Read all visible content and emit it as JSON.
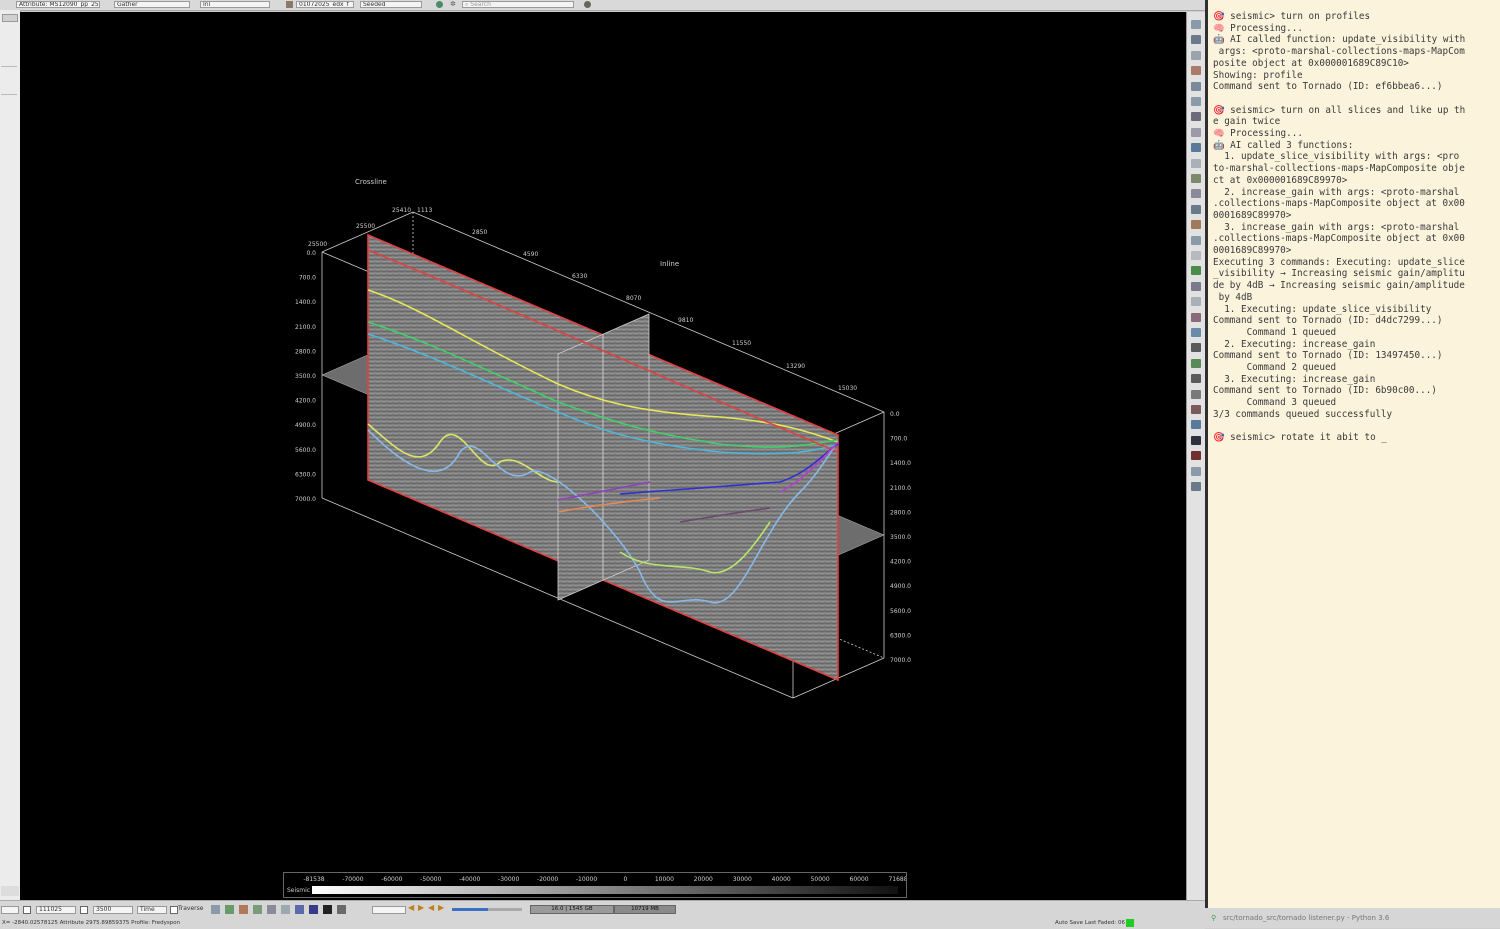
{
  "toolbar": {
    "attribute_field": "Attribute: MS12090_pp_25",
    "gather_field": "Gather",
    "axis_field": "Inl",
    "survey_field": "01072025_edx_f",
    "mode_field": "Seeded",
    "search_placeholder": "Search"
  },
  "viewer": {
    "crossline_label": "Crossline",
    "inline_label": "Inline",
    "top_tick_labels": [
      "25500",
      "25410",
      "1113",
      "2850",
      "4590",
      "6330",
      "8070",
      "9810",
      "11550",
      "13290",
      "15030"
    ],
    "left_depth_labels": [
      "0.0",
      "700.0",
      "1400.0",
      "2100.0",
      "2800.0",
      "3500.0",
      "4200.0",
      "4900.0",
      "5600.0",
      "6300.0",
      "7000.0"
    ],
    "left_top_label": "25500",
    "right_depth_labels": [
      "0.0",
      "700.0",
      "1400.0",
      "2100.0",
      "2800.0",
      "3500.0",
      "4200.0",
      "4900.0",
      "5600.0",
      "6300.0",
      "7000.0"
    ],
    "colorbar_ticks": [
      "-81538",
      "-70000",
      "-60000",
      "-50000",
      "-40000",
      "-30000",
      "-20000",
      "-10000",
      "0",
      "10000",
      "20000",
      "30000",
      "40000",
      "50000",
      "60000",
      "71688"
    ],
    "colorbar_label": "Seismic"
  },
  "terminal": {
    "lines": [
      {
        "text": "🎯 seismic> turn on profiles",
        "cls": "pr"
      },
      {
        "text": "🧠 Processing...",
        "cls": "pc"
      },
      {
        "text": "🤖 AI called function: update_visibility with",
        "cls": ""
      },
      {
        "text": " args: <proto-marshal-collections-maps-MapCom",
        "cls": ""
      },
      {
        "text": "posite object at 0x000001689C89C10>",
        "cls": ""
      },
      {
        "text": "Showing: profile",
        "cls": ""
      },
      {
        "text": "Command sent to Tornado (ID: ef6bbea6...)",
        "cls": ""
      },
      {
        "text": "",
        "cls": "blank"
      },
      {
        "text": "🎯 seismic> turn on all slices and like up th",
        "cls": "pr"
      },
      {
        "text": "e gain twice",
        "cls": ""
      },
      {
        "text": "🧠 Processing...",
        "cls": "pc"
      },
      {
        "text": "🤖 AI called 3 functions:",
        "cls": ""
      },
      {
        "text": "  1. update_slice_visibility with args: <pro",
        "cls": ""
      },
      {
        "text": "to-marshal-collections-maps-MapComposite obje",
        "cls": ""
      },
      {
        "text": "ct at 0x000001689C89970>",
        "cls": ""
      },
      {
        "text": "  2. increase_gain with args: <proto-marshal",
        "cls": ""
      },
      {
        "text": ".collections-maps-MapComposite object at 0x00",
        "cls": ""
      },
      {
        "text": "0001689C89970>",
        "cls": ""
      },
      {
        "text": "  3. increase_gain with args: <proto-marshal",
        "cls": ""
      },
      {
        "text": ".collections-maps-MapComposite object at 0x00",
        "cls": ""
      },
      {
        "text": "0001689C89970>",
        "cls": ""
      },
      {
        "text": "Executing 3 commands: Executing: update_slice",
        "cls": ""
      },
      {
        "text": "_visibility → Increasing seismic gain/amplitu",
        "cls": ""
      },
      {
        "text": "de by 4dB → Increasing seismic gain/amplitude",
        "cls": ""
      },
      {
        "text": " by 4dB",
        "cls": ""
      },
      {
        "text": "  1. Executing: update_slice_visibility",
        "cls": ""
      },
      {
        "text": "Command sent to Tornado (ID: d4dc7299...)",
        "cls": ""
      },
      {
        "text": "      Command 1 queued",
        "cls": ""
      },
      {
        "text": "  2. Executing: increase_gain",
        "cls": ""
      },
      {
        "text": "Command sent to Tornado (ID: 13497450...)",
        "cls": ""
      },
      {
        "text": "      Command 2 queued",
        "cls": ""
      },
      {
        "text": "  3. Executing: increase_gain",
        "cls": ""
      },
      {
        "text": "Command sent to Tornado (ID: 6b90c00...)",
        "cls": ""
      },
      {
        "text": "      Command 3 queued",
        "cls": ""
      },
      {
        "text": "3/3 commands queued successfully",
        "cls": ""
      },
      {
        "text": "",
        "cls": "blank"
      },
      {
        "text": "🎯 seismic> rotate it abit to _",
        "cls": "pr"
      }
    ]
  },
  "bottombar": {
    "y_value": "111025",
    "z_value": "3500",
    "time_label": "Time",
    "traverse_label": "Traverse",
    "status_mem": "16.0 | 1545 GB",
    "status_mb": "10719 MB",
    "coords_text": "X= -2840.02578125 Attribute 2975.89859375 Profile: Fredyspon",
    "autosave_text": "Auto Save Last Faded: 06"
  },
  "taskbar": {
    "title": "src/tornado_src/tornado listener.py - Python 3.6"
  }
}
